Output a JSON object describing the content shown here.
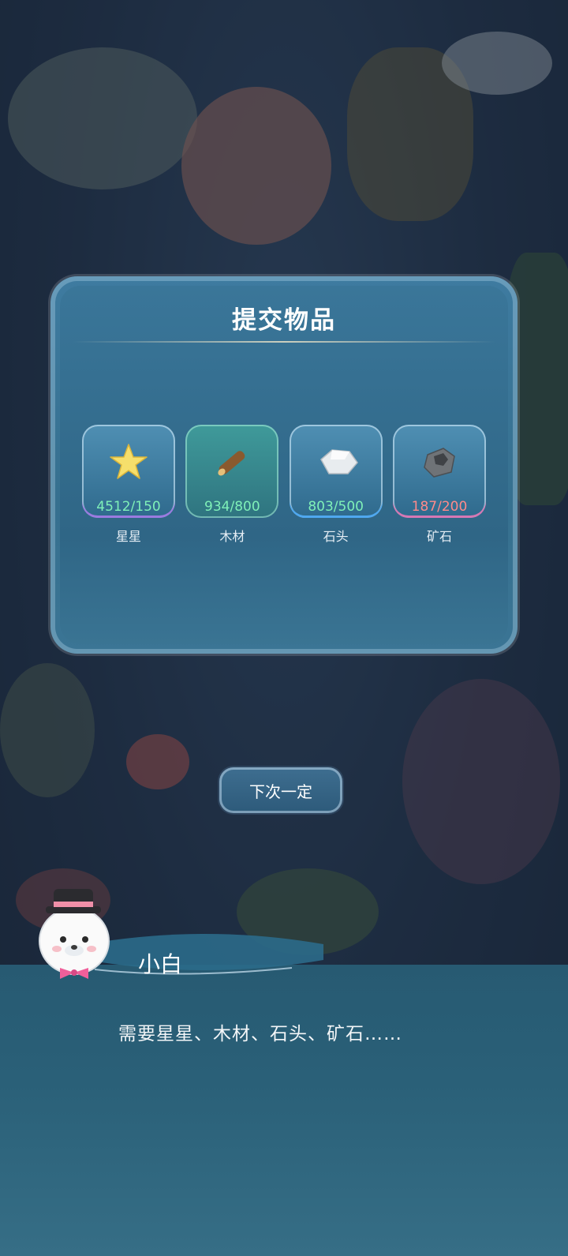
{
  "dialog": {
    "title": "提交物品",
    "items": [
      {
        "name": "星星",
        "count": "4512/150",
        "count_color": "#7ff0b8",
        "icon": "star-icon"
      },
      {
        "name": "木材",
        "count": "934/800",
        "count_color": "#7ff0b8",
        "icon": "wood-log-icon"
      },
      {
        "name": "石头",
        "count": "803/500",
        "count_color": "#7ff0b8",
        "icon": "stone-icon"
      },
      {
        "name": "矿石",
        "count": "187/200",
        "count_color": "#ff8a8a",
        "icon": "ore-icon"
      }
    ]
  },
  "actions": {
    "next_button": "下次一定"
  },
  "conversation": {
    "speaker": "小白",
    "text": "需要星星、木材、石头、矿石……"
  }
}
